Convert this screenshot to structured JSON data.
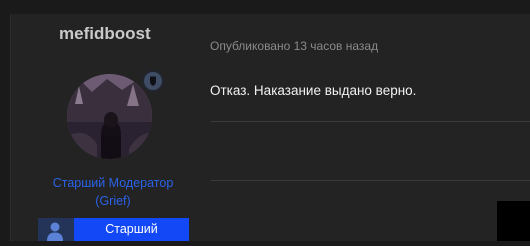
{
  "author": {
    "name": "mefidboost",
    "role_line1": "Старший Модератор",
    "role_line2": "(Grief)",
    "badge_label": "Старший"
  },
  "post": {
    "published": "Опубликовано 13 часов назад",
    "text": "Отказ. Наказание выдано верно."
  },
  "icons": {
    "status": "shield-icon",
    "badge": "user-icon"
  },
  "colors": {
    "role_text": "#2a63e8",
    "badge_bg": "#1248f5",
    "badge_icon_bg": "#243458"
  }
}
